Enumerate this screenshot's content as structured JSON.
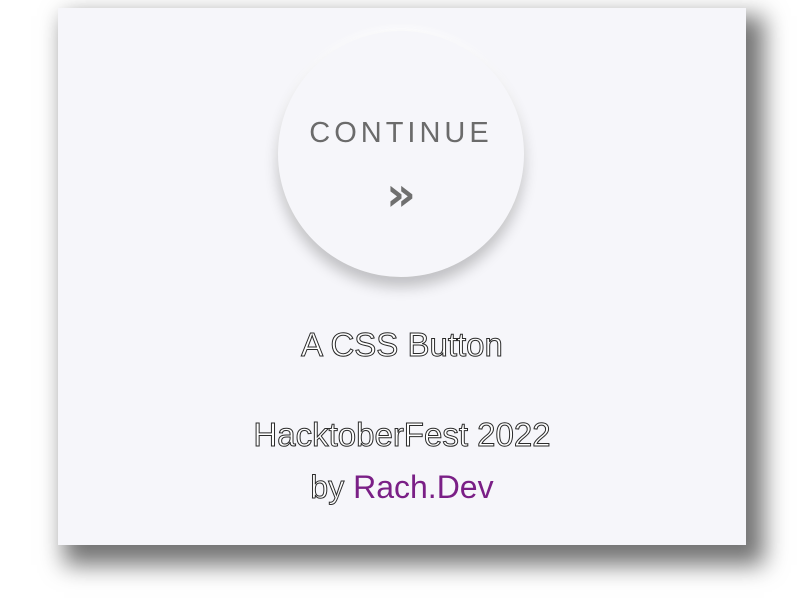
{
  "button": {
    "label": "CONTINUE",
    "icon": "double-chevron-right-icon",
    "icon_glyph": "»"
  },
  "caption": {
    "title": "A CSS Button",
    "event": "HacktoberFest 2022",
    "by": "by",
    "author": "Rach.Dev"
  },
  "colors": {
    "card_background": "#f6f6fa",
    "button_text": "#6b6b6b",
    "author_link": "#7a1f86"
  }
}
